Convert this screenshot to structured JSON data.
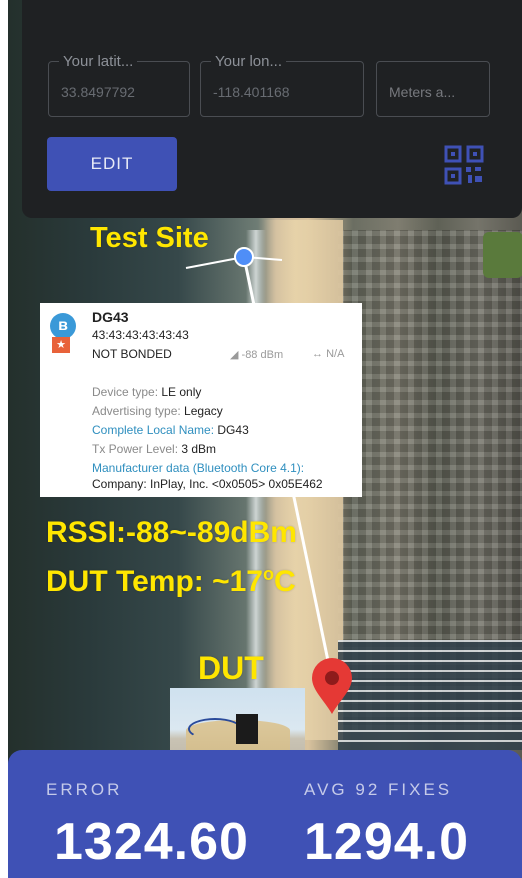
{
  "settings_card": {
    "latitude": {
      "label": "Your latit...",
      "value": "33.8497792"
    },
    "longitude": {
      "label": "Your lon...",
      "value": "-118.401168"
    },
    "meters": {
      "placeholder": "Meters a..."
    },
    "edit_label": "EDIT"
  },
  "annotations": {
    "test_site": "Test Site",
    "rssi": "RSSI:-88~-89dBm",
    "dut_temp_prefix": "DUT Temp: ~17",
    "dut_temp_sup": "o",
    "dut_temp_suffix": "C",
    "dut": "DUT"
  },
  "device": {
    "name": "DG43",
    "address": "43:43:43:43:43:43",
    "bond": "NOT BONDED",
    "rssi": "-88 dBm",
    "interval": "N/A",
    "type_label": "Device type: ",
    "type_value": "LE only",
    "adv_label": "Advertising type: ",
    "adv_value": "Legacy",
    "local_name_label": "Complete Local Name: ",
    "local_name_value": "DG43",
    "tx_label": "Tx Power Level: ",
    "tx_value": "3 dBm",
    "mfr_label": "Manufacturer data (Bluetooth Core 4.1):",
    "mfr_value": "Company: InPlay, Inc. <0x0505> 0x05E462"
  },
  "stats": {
    "error_label": "ERROR",
    "avg_label": "AVG 92 FIXES",
    "error_value": "1324.60",
    "avg_value": "1294.0"
  },
  "colors": {
    "accent": "#3f51b5",
    "annotation": "#ffe600",
    "pin": "#e53935",
    "route": "#ffffff"
  },
  "icons": [
    "qr-code-icon",
    "bluetooth-icon",
    "map-pin-icon",
    "location-dot-icon",
    "signal-icon",
    "interval-icon"
  ]
}
